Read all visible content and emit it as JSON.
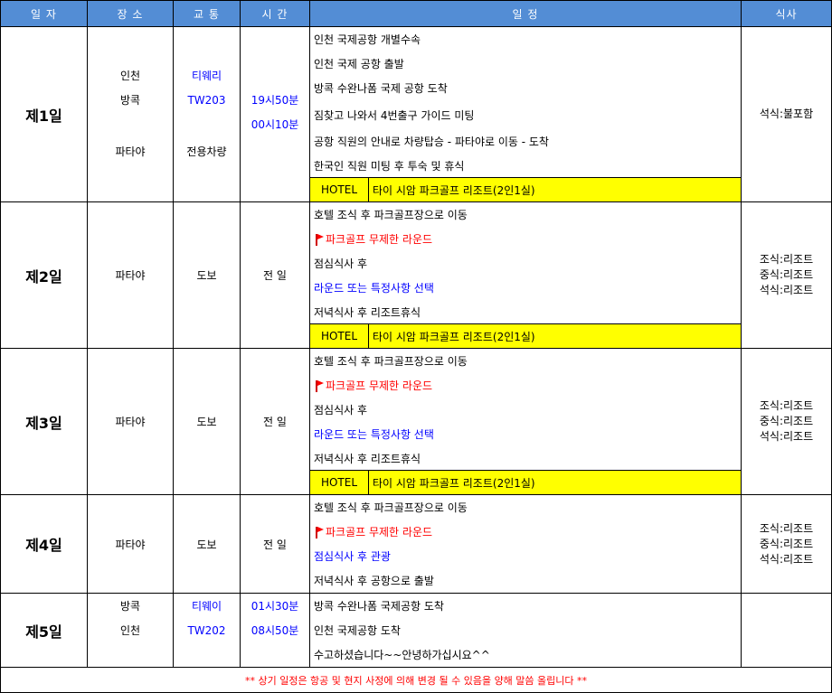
{
  "headers": {
    "day": "일 자",
    "place": "장 소",
    "transport": "교 통",
    "time": "시 간",
    "schedule": "일 정",
    "meal": "식사"
  },
  "hotel_label": "HOTEL",
  "hotel_name": "타이 시암 파크골프 리조트(2인1실)",
  "days": [
    {
      "day": "제1일",
      "places": [
        "인천",
        "방콕",
        "",
        "파타야"
      ],
      "transport": [
        "티웨리",
        "TW203",
        "",
        "전용차량"
      ],
      "times": [
        "",
        "19시50분",
        "00시10분",
        ""
      ],
      "schedule": [
        "인천 국제공항 개별수속",
        "인천 국제 공항 출발",
        "방콕 수완나폼 국제 공항 도착",
        "짐찾고 나와서 4번출구 가이드 미팅",
        "공항 직원의 안내로 차량탑승 - 파타야로  이동 - 도착",
        "한국인 직원 미팅 후 투숙 및 휴식"
      ],
      "meal": [
        "석식:불포함"
      ]
    },
    {
      "day": "제2일",
      "place": "파타야",
      "transport": "도보",
      "time": "전 일",
      "schedule": [
        "호텔 조식 후 파크골프장으로 이동",
        "파크골프 무제한 라운드",
        "점심식사 후",
        "라운드 또는 특정사항 선택",
        "저녁식사 후 리조트휴식"
      ],
      "meal": [
        "조식:리조트",
        "중식:리조트",
        "석식:리조트"
      ]
    },
    {
      "day": "제3일",
      "place": "파타야",
      "transport": "도보",
      "time": "전 일",
      "schedule": [
        "호텔 조식 후 파크골프장으로 이동",
        "파크골프 무제한 라운드",
        "점심식사 후",
        "라운드 또는 특정사항 선택",
        "저녁식사 후 리조트휴식"
      ],
      "meal": [
        "조식:리조트",
        "중식:리조트",
        "석식:리조트"
      ]
    },
    {
      "day": "제4일",
      "place": "파타야",
      "transport": "도보",
      "time": "전 일",
      "schedule": [
        "호텔 조식 후 파크골프장으로 이동",
        "파크골프 무제한 라운드",
        "점심식사 후 관광",
        "저녁식사 후 공항으로 출발"
      ],
      "meal": [
        "조식:리조트",
        "중식:리조트",
        "석식:리조트"
      ]
    },
    {
      "day": "제5일",
      "places": [
        "방콕",
        "인천",
        ""
      ],
      "transport": [
        "티웨이",
        "TW202",
        ""
      ],
      "times": [
        "01시30분",
        "08시50분",
        ""
      ],
      "schedule": [
        "방콕 수완나폼 국제공항 도착",
        "인천 국제공항 도착",
        "수고하셨습니다~~안녕하가십시요^^"
      ],
      "meal": []
    }
  ],
  "footer": "** 상기 일정은 항공 및 현지 사정에 의해 변경 될 수 있음을 양해 말씀 올립니다 **",
  "colors": {
    "header_bg": "#538dd5",
    "hotel_bg": "#ffff00",
    "accent_blue": "#0000ff",
    "accent_red": "#ff0000"
  }
}
